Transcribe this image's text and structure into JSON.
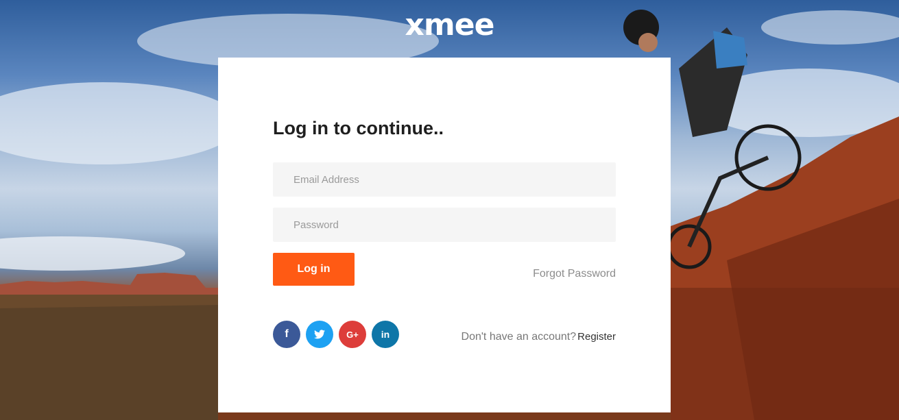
{
  "brand": {
    "logo_text": "xmee",
    "accent": "#ff5a14"
  },
  "login": {
    "title": "Log in to continue..",
    "email_placeholder": "Email Address",
    "password_placeholder": "Password",
    "submit_label": "Log in",
    "forgot_label": "Forgot Password"
  },
  "social": [
    {
      "name": "facebook",
      "glyph": "f",
      "color": "#3b5998"
    },
    {
      "name": "twitter",
      "glyph": "twitter-bird-icon",
      "color": "#1da1f2"
    },
    {
      "name": "google-plus",
      "glyph": "G+",
      "color": "#dd3d3a"
    },
    {
      "name": "linkedin",
      "glyph": "in",
      "color": "#0e76a8"
    }
  ],
  "register": {
    "question": "Don't have an account?",
    "link_label": "Register"
  }
}
